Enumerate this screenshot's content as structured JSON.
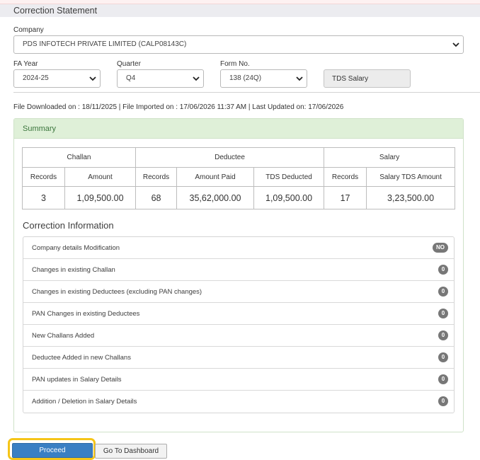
{
  "header": {
    "title": "Correction Statement"
  },
  "company": {
    "label": "Company",
    "value": "PDS INFOTECH PRIVATE LIMITED (CALP08143C)"
  },
  "fa_year": {
    "label": "FA Year",
    "value": "2024-25"
  },
  "quarter": {
    "label": "Quarter",
    "value": "Q4"
  },
  "form_no": {
    "label": "Form No.",
    "value": "138 (24Q)"
  },
  "tds_salary": {
    "label": "TDS Salary"
  },
  "status": {
    "text": "File Downloaded on : 18/11/2025 | File Imported on : 17/06/2026 11:37 AM | Last Updated on: 17/06/2026"
  },
  "summary": {
    "title": "Summary",
    "groups": [
      "Challan",
      "Deductee",
      "Salary"
    ],
    "columns": [
      "Records",
      "Amount",
      "Records",
      "Amount Paid",
      "TDS Deducted",
      "Records",
      "Salary TDS Amount"
    ],
    "values": [
      "3",
      "1,09,500.00",
      "68",
      "35,62,000.00",
      "1,09,500.00",
      "17",
      "3,23,500.00"
    ]
  },
  "correction": {
    "title": "Correction Information",
    "items": [
      {
        "label": "Company details Modification",
        "badge": "NO"
      },
      {
        "label": "Changes in existing Challan",
        "badge": "0"
      },
      {
        "label": "Changes in existing Deductees (excluding PAN changes)",
        "badge": "0"
      },
      {
        "label": "PAN Changes in existing Deductees",
        "badge": "0"
      },
      {
        "label": "New Challans Added",
        "badge": "0"
      },
      {
        "label": "Deductee Added in new Challans",
        "badge": "0"
      },
      {
        "label": "PAN updates in Salary Details",
        "badge": "0"
      },
      {
        "label": "Addition / Deletion in Salary Details",
        "badge": "0"
      }
    ]
  },
  "actions": {
    "proceed": "Proceed",
    "dashboard": "Go To Dashboard"
  }
}
